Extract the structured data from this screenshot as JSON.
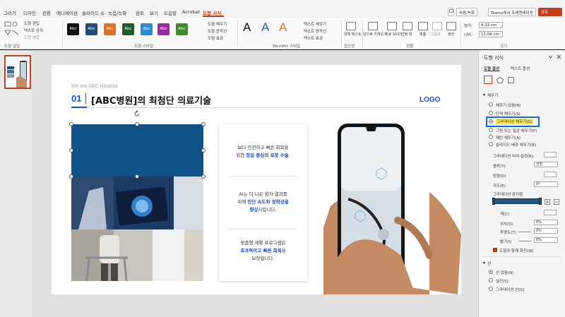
{
  "tabs": [
    "그리기",
    "디자인",
    "전환",
    "애니메이션",
    "슬라이드 쇼",
    "녹음/녹화",
    "검토",
    "보기",
    "도움말",
    "Acrobat",
    "도형 서식"
  ],
  "top_buttons": {
    "record": "녹음/녹화",
    "teams": "Teams에서 프레젠테이션",
    "share": "공유"
  },
  "ribbon": {
    "insert_shapes_label": "도형 삽입",
    "edit_shape": "도형 편집",
    "textbox": "텍스트 상자",
    "merge_shapes": "도형 병합",
    "shape_styles_label": "도형 스타일",
    "style_swatches": [
      "Abc",
      "Abc",
      "Abc",
      "Abc",
      "Abc",
      "Abc",
      "Abc"
    ],
    "shape_fill": "도형 채우기",
    "shape_outline": "도형 윤곽선",
    "shape_effects": "도형 효과",
    "wordart_letters": [
      "A",
      "A",
      "A"
    ],
    "text_fill": "텍스트 채우기",
    "text_outline": "텍스트 윤곽선",
    "text_effects": "텍스트 효과",
    "wordart_label": "WordArt 스타일",
    "alt_text": "대체 텍스트",
    "accessibility_label": "접근성",
    "bring_forward": "앞으로 가져오기",
    "send_backward": "뒤로 보내기",
    "selection_pane": "선택 창",
    "align": "맞춤",
    "group": "그룹화",
    "rotate": "회전",
    "arrange_label": "정렬",
    "height_label": "높이:",
    "height_value": "4.32 cm",
    "width_label": "너비:",
    "width_value": "11.04 cm",
    "size_label": "크기"
  },
  "slide": {
    "kicker": "We are ABC Hospital",
    "number": "01",
    "title": "[ABC병원]의 최첨단 의료기술",
    "logo": "LOGO",
    "blocks": [
      {
        "line1": "보다 안전하고 빠른 회복을",
        "line2_pre": "위한 ",
        "line2_bold": "정밀 중심의 로봇 수술",
        "line2_post": "."
      },
      {
        "line1": "AI는 더 나은 환자 결과를",
        "line2_pre": "위해 ",
        "line2_bold": "진단 속도와 정확성을",
        "line3_bold": "향상",
        "line3_post": "시킵니다."
      },
      {
        "line1": "맞춤형 재활 프로그램은",
        "line2_bold": "효과적이고 빠른 회복",
        "line2_post": "을",
        "line3": "보장합니다."
      }
    ]
  },
  "pane": {
    "title": "도형 서식",
    "tab_shape_options": "도형 옵션",
    "tab_text_options": "텍스트 옵션",
    "fill_section": "채우기",
    "fill_options": [
      "채우기 없음(N)",
      "단색 채우기(S)",
      "그라데이션 채우기(G)",
      "그림 또는 질감 채우기(P)",
      "패턴 채우기(A)",
      "슬라이드 배경 채우기(B)"
    ],
    "preset_gradient": "그라데이션 미리 설정(R)",
    "type_label": "종류(Y)",
    "type_value": "선형",
    "direction_label": "방향(D)",
    "angle_label": "각도(E)",
    "angle_value": "0°",
    "stops_label": "그라데이션 중지점",
    "color_label": "색(C)",
    "position_label": "위치(O)",
    "position_value": "0%",
    "transparency_label": "투명도(T)",
    "transparency_value": "0%",
    "brightness_label": "밝기(I)",
    "brightness_value": "0%",
    "rotate_with_shape": "도형과 함께 회전(W)",
    "line_section": "선",
    "line_options": [
      "선 없음(N)",
      "실선(S)",
      "그라데이션 선(G)"
    ]
  },
  "colors": {
    "accent": "#c43e1c",
    "slide_blue": "#1a4fd6",
    "shape_blue": "#0d5288",
    "highlight": "#0a6fd6"
  }
}
